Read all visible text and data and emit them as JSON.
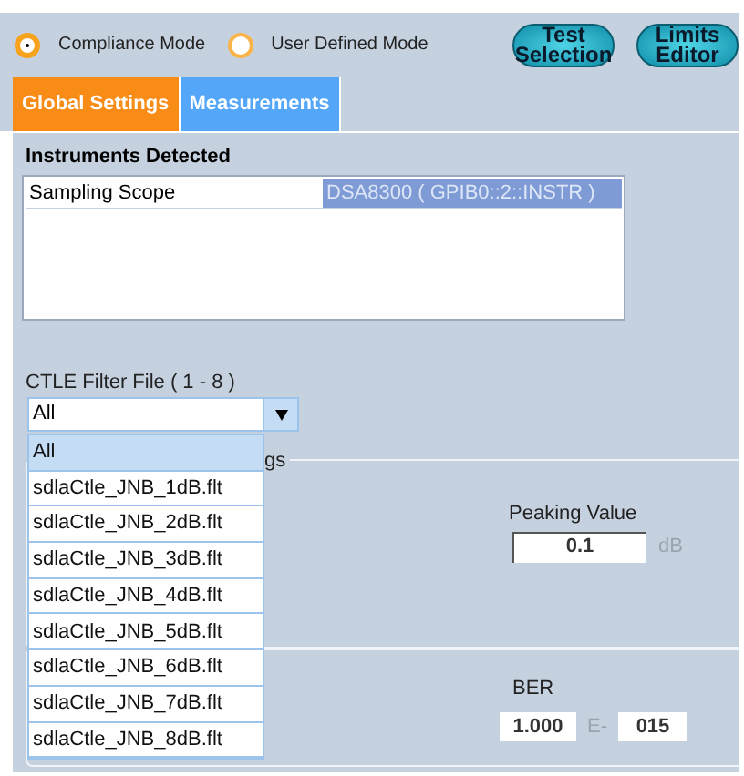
{
  "modes": [
    {
      "label": "Compliance Mode",
      "selected": true
    },
    {
      "label": "User Defined Mode",
      "selected": false
    }
  ],
  "buttons": [
    [
      "Test",
      "Selection"
    ],
    [
      "Limits",
      "Editor"
    ]
  ],
  "tabs": [
    {
      "label": "Global Settings",
      "selected": true
    },
    {
      "label": "Measurements",
      "selected": false
    }
  ],
  "instruments": {
    "title": "Instruments Detected",
    "rows": [
      {
        "name": "Sampling Scope",
        "value": "DSA8300 ( GPIB0::2::INSTR )",
        "selected": true
      }
    ]
  },
  "ctle": {
    "label": "CTLE Filter File ( 1 - 8 )",
    "value": "All",
    "options": [
      {
        "label": "All",
        "selected": true
      },
      {
        "label": "sdlaCtle_JNB_1dB.flt",
        "selected": false
      },
      {
        "label": "sdlaCtle_JNB_2dB.flt",
        "selected": false
      },
      {
        "label": "sdlaCtle_JNB_3dB.flt",
        "selected": false
      },
      {
        "label": "sdlaCtle_JNB_4dB.flt",
        "selected": false
      },
      {
        "label": "sdlaCtle_JNB_5dB.flt",
        "selected": false
      },
      {
        "label": "sdlaCtle_JNB_6dB.flt",
        "selected": false
      },
      {
        "label": "sdlaCtle_JNB_7dB.flt",
        "selected": false
      },
      {
        "label": "sdlaCtle_JNB_8dB.flt",
        "selected": false
      }
    ]
  },
  "peaking_group": {
    "title": "gs",
    "label": "Peaking Value",
    "value": "0.1",
    "unit": "dB"
  },
  "ber_group": {
    "label": "BER",
    "mantissa": "1.000",
    "separator": "E-",
    "exponent": "015"
  }
}
